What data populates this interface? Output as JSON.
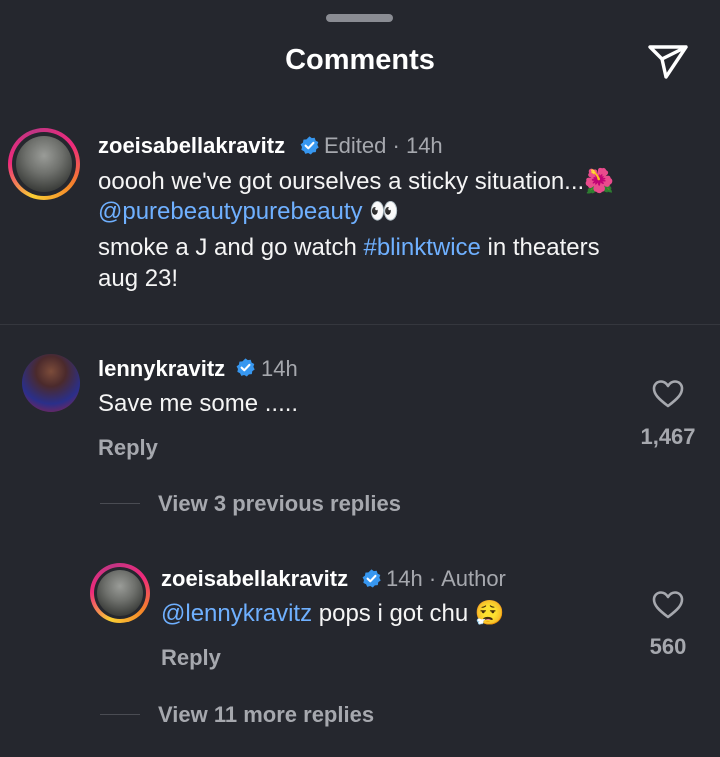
{
  "header": {
    "title": "Comments"
  },
  "post": {
    "username": "zoeisabellakravitz",
    "edited": "Edited",
    "time": "14h",
    "line1_text": "ooooh we've got ourselves a sticky situation...",
    "line1_emoji": "🌺",
    "mention": "@purebeautypurebeauty",
    "mention_emoji": "👀",
    "line3_pre": "smoke a J and go watch ",
    "hashtag": "#blinktwice",
    "line3_post": " in theaters",
    "line4": "aug 23!"
  },
  "comments": [
    {
      "username": "lennykravitz",
      "time": "14h",
      "text": "Save me some .....",
      "reply_label": "Reply",
      "likes": "1,467",
      "view_replies": "View 3 previous replies"
    },
    {
      "username": "zoeisabellakravitz",
      "time": "14h",
      "author_label": "Author",
      "mention": "@lennykravitz",
      "text": " pops i got chu ",
      "emoji": "😮‍💨",
      "reply_label": "Reply",
      "likes": "560",
      "view_more": "View 11 more replies"
    }
  ],
  "colors": {
    "background": "#25272e",
    "link": "#6fb0ff",
    "verified": "#3797f0",
    "muted": "#a6a8ae"
  },
  "icons": {
    "send": "paper-plane-icon",
    "verified": "verified-badge-icon",
    "like": "heart-icon"
  }
}
